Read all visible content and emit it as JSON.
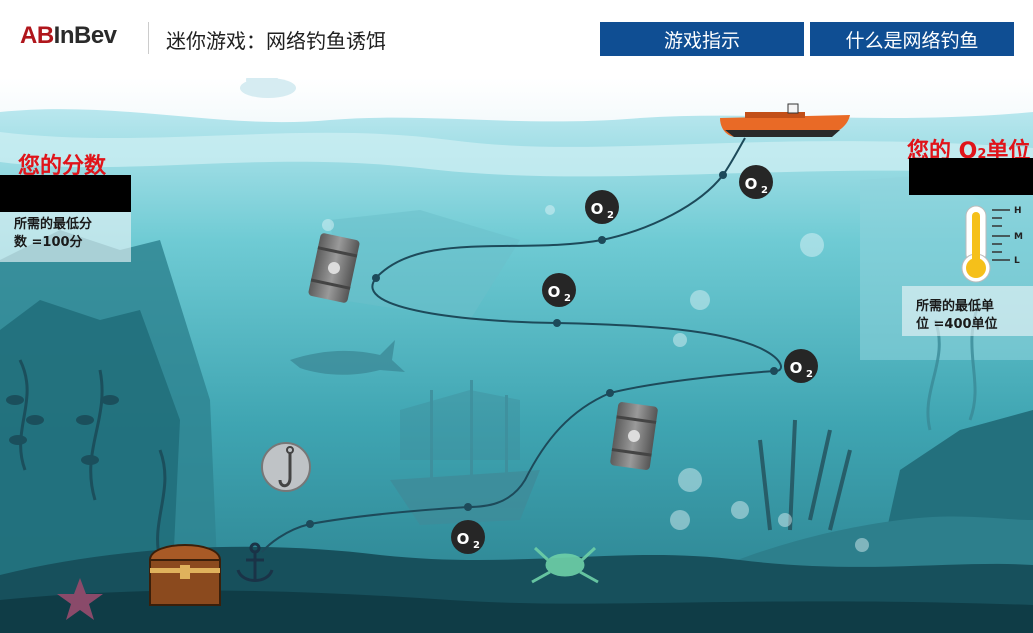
{
  "header": {
    "logo_ab": "AB",
    "logo_inbev": "InBev",
    "title": "迷你游戏：网络钓鱼诱饵",
    "buttons": [
      "游戏指示",
      "什么是网络钓鱼"
    ]
  },
  "score_panel": {
    "title": "您的分数",
    "min_line1": "所需的最低分",
    "min_line2": "数 =100分"
  },
  "oxygen_panel": {
    "title_prefix": "您的 ",
    "title_o": "O",
    "title_sub": "2",
    "title_suffix": "单位",
    "min_line1": "所需的最低单",
    "min_line2": "位 =400单位",
    "gauge_labels": [
      "H",
      "M",
      "L"
    ]
  },
  "tokens": {
    "o2_letter": "O",
    "o2_sub": "2"
  },
  "colors": {
    "brand_red": "#b0161c",
    "button_blue": "#0f4e93",
    "alert_red": "#e0141a",
    "water": "#4fb5c0",
    "gauge_fill": "#f5c01a"
  }
}
